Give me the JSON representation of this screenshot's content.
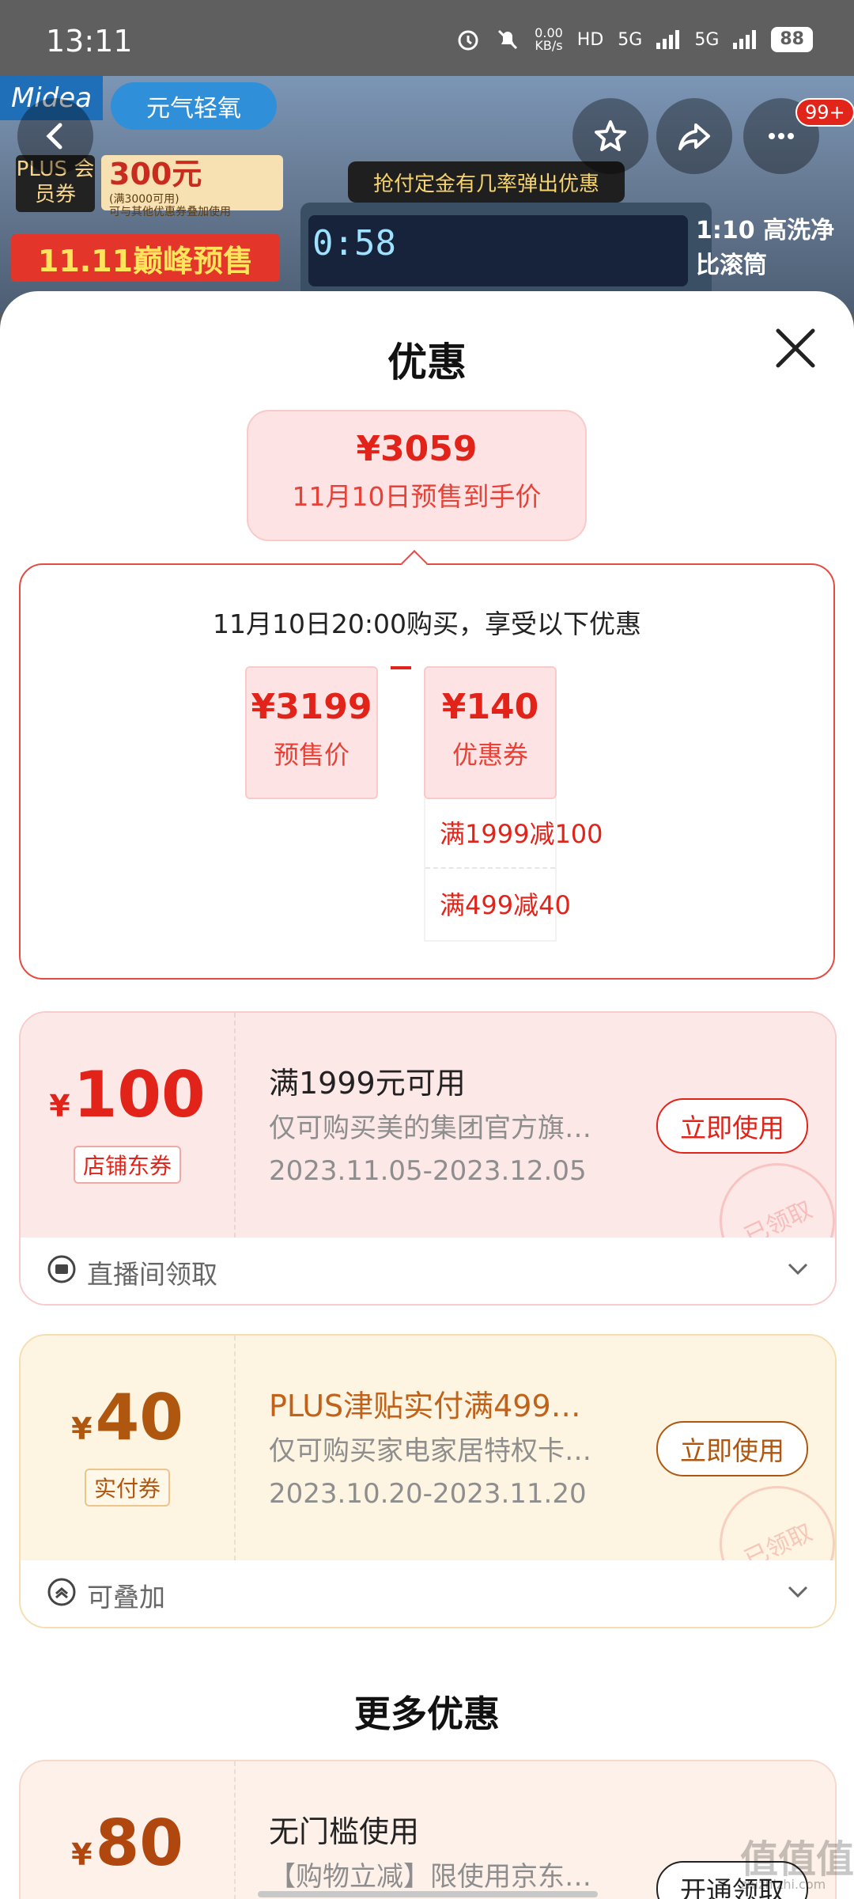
{
  "status_bar": {
    "time": "13:11",
    "net_speed_value": "0.00",
    "net_speed_unit": "KB/s",
    "hd_label": "HD",
    "network_1": "5G",
    "network_2": "5G",
    "battery": "88",
    "icons": [
      "alarm-icon",
      "mute-bell-icon",
      "signal-icon",
      "battery-icon"
    ]
  },
  "banner": {
    "brand": "Midea",
    "brand_sub": "元气轻氧",
    "plus_badge": "PLUS 会员券",
    "coupon_amount": "300元",
    "coupon_condition": "(满3000可用)",
    "coupon_note": "可与其他优惠券叠加使用",
    "presale_tag": "11.11巅峰预售",
    "promo_strip": "抢付定金有几率弹出优惠",
    "device_clock": "0:58",
    "ratio_tag": "1:10 高洗净比滚筒",
    "badge_count": "99+"
  },
  "sheet": {
    "title": "优惠",
    "final_price": "¥3059",
    "final_price_label": "11月10日预售到手价",
    "calc_heading": "11月10日20:00购买，享受以下优惠",
    "presale_price": "¥3199",
    "presale_label": "预售价",
    "coupon_total": "¥140",
    "coupon_total_label": "优惠券",
    "coupon_breakdown": [
      "满1999减100",
      "满499减40"
    ]
  },
  "coupons": [
    {
      "currency": "¥",
      "amount": "100",
      "type": "店铺东券",
      "title": "满1999元可用",
      "desc": "仅可购买美的集团官方旗…",
      "date": "2023.11.05-2023.12.05",
      "button": "立即使用",
      "stamp": "已领取",
      "footer": "直播间领取"
    },
    {
      "currency": "¥",
      "amount": "40",
      "type": "实付券",
      "title": "PLUS津贴实付满499…",
      "desc": "仅可购买家电家居特权卡…",
      "date": "2023.10.20-2023.11.20",
      "button": "立即使用",
      "stamp": "已领取",
      "footer": "可叠加"
    }
  ],
  "more": {
    "title": "更多优惠",
    "coupon": {
      "currency": "¥",
      "amount": "80",
      "title": "无门槛使用",
      "desc": "【购物立减】限使用京东…",
      "button": "开通领取"
    }
  },
  "watermark": {
    "main": "值值值",
    "sub": "zhizhizhi.com"
  },
  "colors": {
    "accent_red": "#e2231a",
    "accent_gold": "#b0570f",
    "sheet_bg": "#ffffff"
  }
}
